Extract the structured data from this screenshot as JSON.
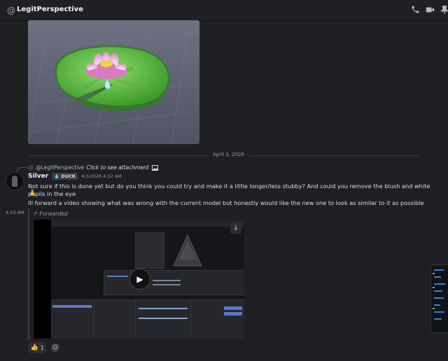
{
  "header": {
    "channel_name": "LegitPerspective",
    "icons": [
      "at-icon",
      "phone-icon",
      "video-call-icon",
      "pin-icon"
    ]
  },
  "messages": {
    "date_divider": "April 3, 2026",
    "reply": {
      "username": "@LegitPerspective",
      "preview": "Click to see attachment",
      "icon": "image-icon"
    },
    "author": "Silver",
    "tag": "DUCK",
    "timestamp": "4/3/2026 4:52 AM",
    "text1": "Not sure if this is done yet but do you think you could try and make it a little longer/less stubby? And could you remove the blush and white pupils in the eye",
    "emoji1": "🙏",
    "text2": "Ill forward a video showing what was wrong with the current model but honestly would like the new one to look as similar to it as possible",
    "timestamp2": "4:53 AM",
    "forwarded_label": "Forwarded",
    "reaction": {
      "emoji": "👍",
      "count": "1"
    }
  },
  "colors": {
    "accent": "#5865f2",
    "lily_green": "#6cc24a",
    "flower_pink": "#e9a1d6"
  }
}
